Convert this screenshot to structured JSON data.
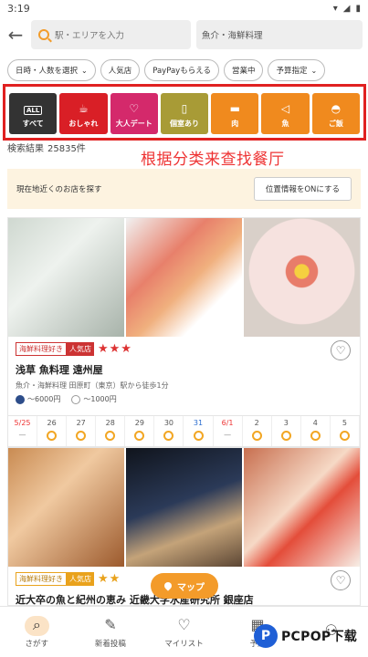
{
  "status": {
    "time": "3:19"
  },
  "search": {
    "area_placeholder": "駅・エリアを入力",
    "genre_value": "魚介・海鮮料理"
  },
  "filters": [
    {
      "label": "日時・人数を選択",
      "chevron": true
    },
    {
      "label": "人気店",
      "chevron": false
    },
    {
      "label": "PayPayもらえる",
      "chevron": false
    },
    {
      "label": "営業中",
      "chevron": false
    },
    {
      "label": "予算指定",
      "chevron": true
    }
  ],
  "categories": [
    {
      "label": "すべて",
      "icon": "ALL",
      "color": "#333333"
    },
    {
      "label": "おしゃれ",
      "icon": "☕",
      "color": "#d91f26"
    },
    {
      "label": "大人デート",
      "icon": "♡",
      "color": "#d4296b"
    },
    {
      "label": "個室あり",
      "icon": "▯",
      "color": "#a89b36"
    },
    {
      "label": "肉",
      "icon": "▬",
      "color": "#f08a1e"
    },
    {
      "label": "魚",
      "icon": "◁",
      "color": "#f08a1e"
    },
    {
      "label": "ご飯",
      "icon": "◓",
      "color": "#f08a1e"
    }
  ],
  "results": {
    "label": "検索結果",
    "count": "25835件"
  },
  "overlay_caption": "根据分类来查找餐厅",
  "location": {
    "text": "現在地近くのお店を探す",
    "button": "位置情報をONにする"
  },
  "restaurants": [
    {
      "tag": "海鮮料理好き",
      "badge": "人気店",
      "stars": "★★★",
      "name": "浅草 魚料理 遠州屋",
      "sub": "魚介・海鮮料理 田原町（東京）駅から徒歩1分",
      "dinner_price": "～6000円",
      "lunch_price": "～1000円",
      "dates": [
        {
          "day": "5/25",
          "status": "—",
          "color": "red"
        },
        {
          "day": "26",
          "status": "○",
          "color": "normal"
        },
        {
          "day": "27",
          "status": "○",
          "color": "normal"
        },
        {
          "day": "28",
          "status": "○",
          "color": "normal"
        },
        {
          "day": "29",
          "status": "○",
          "color": "normal"
        },
        {
          "day": "30",
          "status": "○",
          "color": "normal"
        },
        {
          "day": "31",
          "status": "○",
          "color": "blue"
        },
        {
          "day": "6/1",
          "status": "—",
          "color": "red"
        },
        {
          "day": "2",
          "status": "○",
          "color": "normal"
        },
        {
          "day": "3",
          "status": "○",
          "color": "normal"
        },
        {
          "day": "4",
          "status": "○",
          "color": "normal"
        },
        {
          "day": "5",
          "status": "○",
          "color": "normal"
        }
      ]
    },
    {
      "tag": "海鮮料理好き",
      "badge": "人気店",
      "stars": "★★",
      "name": "近大卒の魚と紀州の恵み 近畿大学水産研究所 銀座店"
    }
  ],
  "map_button": "マップ",
  "bottom_nav": [
    {
      "label": "さがす",
      "icon": "search-icon"
    },
    {
      "label": "新着投稿",
      "icon": "pen-icon"
    },
    {
      "label": "マイリスト",
      "icon": "heart-icon"
    },
    {
      "label": "予約",
      "icon": "calendar-icon"
    },
    {
      "label": "",
      "icon": "user-icon"
    }
  ],
  "watermark": {
    "logo": "P",
    "text": "PCPOP下载"
  }
}
